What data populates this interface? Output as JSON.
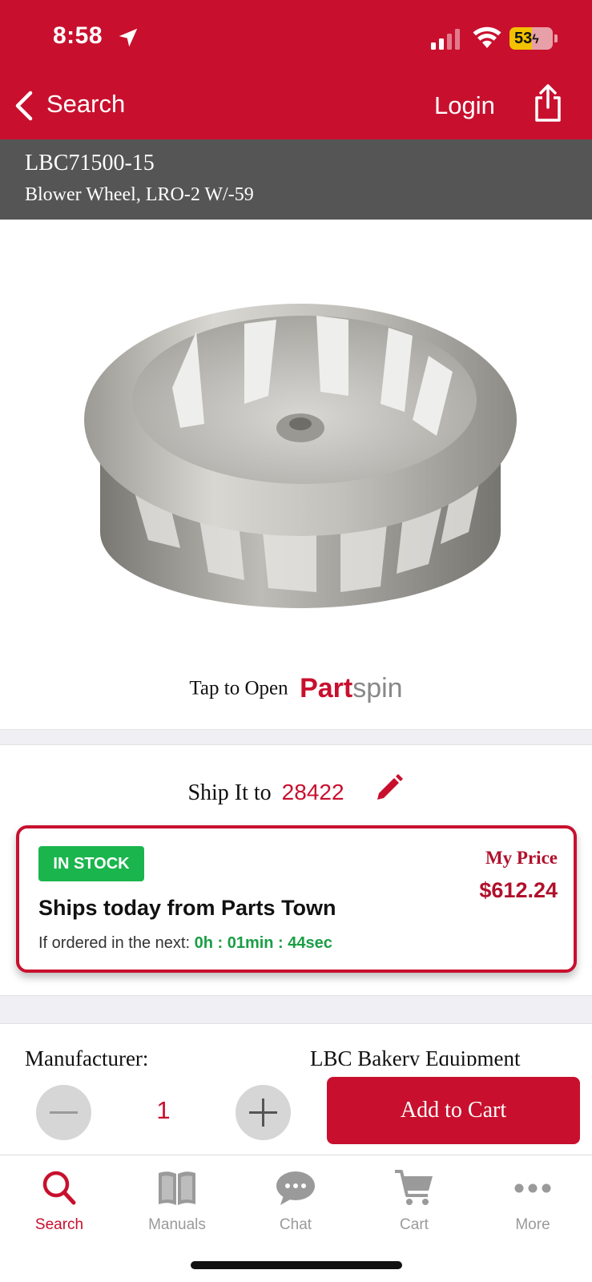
{
  "status_bar": {
    "time": "8:58",
    "battery": "53"
  },
  "nav": {
    "back_label": "Search",
    "login_label": "Login"
  },
  "part": {
    "number": "LBC71500-15",
    "description": "Blower Wheel, LRO-2 W/-59"
  },
  "partspin": {
    "lead": "Tap to Open",
    "logo_bold": "Part",
    "logo_light": "spin"
  },
  "shipping": {
    "label": "Ship It to",
    "zip": "28422"
  },
  "stock": {
    "badge": "IN STOCK",
    "ships_today": "Ships today from Parts Town",
    "countdown_lead": "If ordered in the next:",
    "countdown": "0h : 01min : 44sec",
    "price_label": "My Price",
    "price": "$612.24"
  },
  "details": {
    "manufacturer_label": "Manufacturer:",
    "manufacturer_value": "LBC Bakery Equipment"
  },
  "cart": {
    "quantity": "1",
    "add_label": "Add to Cart"
  },
  "tabs": [
    {
      "label": "Search",
      "icon": "search-icon",
      "active": true
    },
    {
      "label": "Manuals",
      "icon": "book-icon",
      "active": false
    },
    {
      "label": "Chat",
      "icon": "chat-bubble-icon",
      "active": false
    },
    {
      "label": "Cart",
      "icon": "cart-icon",
      "active": false
    },
    {
      "label": "More",
      "icon": "more-dots-icon",
      "active": false
    }
  ],
  "colors": {
    "brand_red": "#c8102e",
    "stock_green": "#1ab54d",
    "part_bar_gray": "#555555"
  }
}
